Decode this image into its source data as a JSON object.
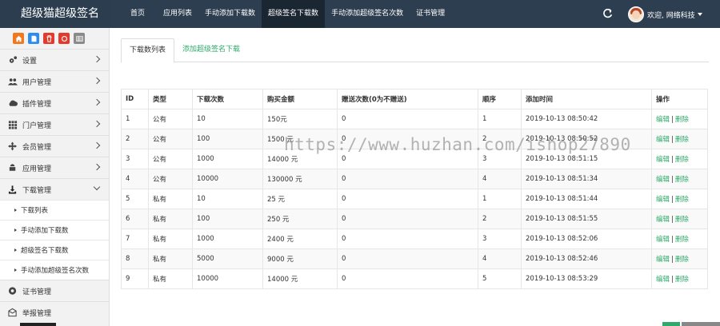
{
  "app": {
    "title": "超级猫超级签名"
  },
  "nav": {
    "items": [
      {
        "label": "首页",
        "active": false
      },
      {
        "label": "应用列表",
        "active": false
      },
      {
        "label": "手动添加下载数",
        "active": false
      },
      {
        "label": "超级签名下载数",
        "active": true
      },
      {
        "label": "手动添加超级签名次数",
        "active": false
      },
      {
        "label": "证书管理",
        "active": false
      }
    ]
  },
  "user": {
    "greeting": "欢迎, 网络科技"
  },
  "sidebar": {
    "shortcuts": [
      {
        "icon": "home-icon",
        "color": "#f0781e"
      },
      {
        "icon": "file-icon",
        "color": "#2d8cf0"
      },
      {
        "icon": "trash-icon",
        "color": "#e23b2e"
      },
      {
        "icon": "recycle-icon",
        "color": "#e23b2e"
      },
      {
        "icon": "table-icon",
        "color": "#8a8a8a"
      }
    ],
    "items": [
      {
        "label": "设置",
        "icon": "gears-icon"
      },
      {
        "label": "用户管理",
        "icon": "users-icon"
      },
      {
        "label": "插件管理",
        "icon": "cloud-icon"
      },
      {
        "label": "门户管理",
        "icon": "grid-icon"
      },
      {
        "label": "会员管理",
        "icon": "move-icon"
      },
      {
        "label": "应用管理",
        "icon": "android-icon"
      },
      {
        "label": "下载管理",
        "icon": "download-icon"
      }
    ],
    "sub_items": [
      {
        "label": "下载列表"
      },
      {
        "label": "手动添加下载数"
      },
      {
        "label": "超级签名下载数"
      },
      {
        "label": "手动添加超级签名次数"
      }
    ],
    "bottom_items": [
      {
        "label": "证书管理",
        "icon": "certificate-icon"
      },
      {
        "label": "举报管理",
        "icon": "envelope-icon"
      }
    ]
  },
  "tabs": [
    {
      "label": "下载数列表",
      "active": true
    },
    {
      "label": "添加超级签名下载",
      "active": false
    }
  ],
  "table": {
    "headers": [
      "ID",
      "类型",
      "下载次数",
      "购买金额",
      "赠送次数(0为不赠送)",
      "顺序",
      "添加时间",
      "操作"
    ],
    "rows": [
      [
        "1",
        "公有",
        "10",
        "150元",
        "0",
        "1",
        "2019-10-13 08:50:42"
      ],
      [
        "2",
        "公有",
        "100",
        "1500 元",
        "0",
        "2",
        "2019-10-13 08:50:52"
      ],
      [
        "3",
        "公有",
        "1000",
        "14000 元",
        "0",
        "3",
        "2019-10-13 08:51:15"
      ],
      [
        "4",
        "公有",
        "10000",
        "130000 元",
        "0",
        "4",
        "2019-10-13 08:51:34"
      ],
      [
        "5",
        "私有",
        "10",
        "25 元",
        "0",
        "1",
        "2019-10-13 08:51:44"
      ],
      [
        "6",
        "私有",
        "100",
        "250 元",
        "0",
        "2",
        "2019-10-13 08:51:55"
      ],
      [
        "7",
        "私有",
        "1000",
        "2400 元",
        "0",
        "3",
        "2019-10-13 08:52:06"
      ],
      [
        "8",
        "私有",
        "5000",
        "9000 元",
        "0",
        "4",
        "2019-10-13 08:52:46"
      ],
      [
        "9",
        "私有",
        "10000",
        "14000 元",
        "0",
        "5",
        "2019-10-13 08:53:29"
      ]
    ],
    "edit_label": "编辑",
    "delete_label": "删除",
    "separator": "|"
  },
  "watermark": "https://www.huzhan.com/ishop27890",
  "colors": {
    "navbar": "#2d3e50",
    "accent": "#2eaa6a"
  }
}
